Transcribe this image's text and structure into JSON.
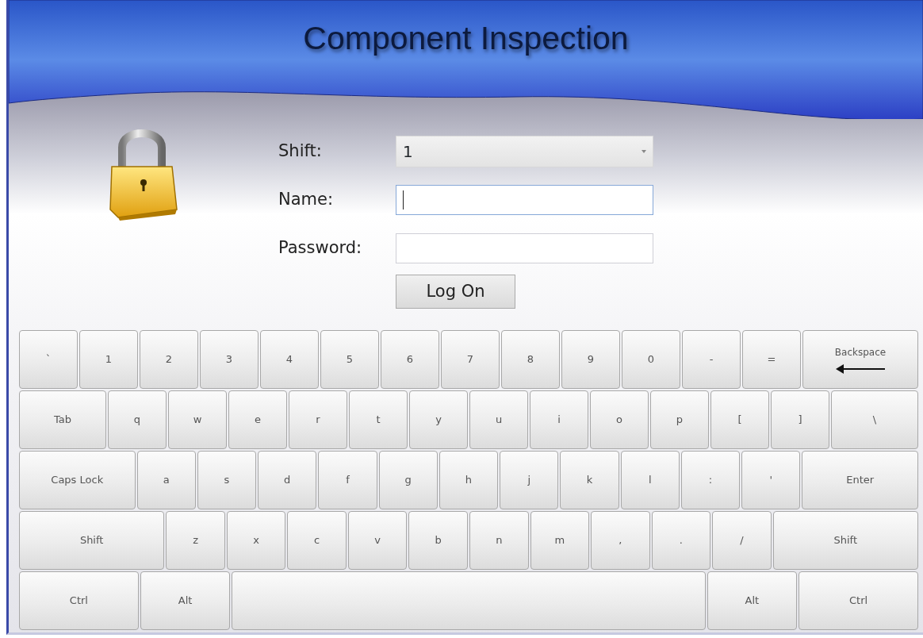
{
  "window": {
    "title": "Component Inspection"
  },
  "form": {
    "fields": [
      {
        "kind": "select",
        "label": "Shift:",
        "value": "1",
        "focused": false
      },
      {
        "kind": "text",
        "label": "Name:",
        "focused": true
      },
      {
        "kind": "password",
        "label": "Password:",
        "focused": false
      }
    ],
    "button": "Log On"
  },
  "keyboard": {
    "rows": [
      [
        {
          "kind": "char",
          "label": "`"
        },
        {
          "kind": "char",
          "label": "1"
        },
        {
          "kind": "char",
          "label": "2"
        },
        {
          "kind": "char",
          "label": "3"
        },
        {
          "kind": "char",
          "label": "4"
        },
        {
          "kind": "char",
          "label": "5"
        },
        {
          "kind": "char",
          "label": "6"
        },
        {
          "kind": "char",
          "label": "7"
        },
        {
          "kind": "char",
          "label": "8"
        },
        {
          "kind": "char",
          "label": "9"
        },
        {
          "kind": "char",
          "label": "0"
        },
        {
          "kind": "char",
          "label": "-"
        },
        {
          "kind": "char",
          "label": "="
        },
        {
          "kind": "backspace",
          "label": "Backspace"
        }
      ],
      [
        {
          "kind": "tab",
          "label": "Tab"
        },
        {
          "kind": "char",
          "label": "q"
        },
        {
          "kind": "char",
          "label": "w"
        },
        {
          "kind": "char",
          "label": "e"
        },
        {
          "kind": "char",
          "label": "r"
        },
        {
          "kind": "char",
          "label": "t"
        },
        {
          "kind": "char",
          "label": "y"
        },
        {
          "kind": "char",
          "label": "u"
        },
        {
          "kind": "char",
          "label": "i"
        },
        {
          "kind": "char",
          "label": "o"
        },
        {
          "kind": "char",
          "label": "p"
        },
        {
          "kind": "char",
          "label": "["
        },
        {
          "kind": "char",
          "label": "]"
        },
        {
          "kind": "tab",
          "label": "\\"
        }
      ],
      [
        {
          "kind": "caps",
          "label": "Caps Lock"
        },
        {
          "kind": "char",
          "label": "a"
        },
        {
          "kind": "char",
          "label": "s"
        },
        {
          "kind": "char",
          "label": "d"
        },
        {
          "kind": "char",
          "label": "f"
        },
        {
          "kind": "char",
          "label": "g"
        },
        {
          "kind": "char",
          "label": "h"
        },
        {
          "kind": "char",
          "label": "j"
        },
        {
          "kind": "char",
          "label": "k"
        },
        {
          "kind": "char",
          "label": "l"
        },
        {
          "kind": "char",
          "label": ":"
        },
        {
          "kind": "char",
          "label": "'"
        },
        {
          "kind": "caps",
          "label": "Enter"
        }
      ],
      [
        {
          "kind": "shift",
          "label": "Shift"
        },
        {
          "kind": "char",
          "label": "z"
        },
        {
          "kind": "char",
          "label": "x"
        },
        {
          "kind": "char",
          "label": "c"
        },
        {
          "kind": "char",
          "label": "v"
        },
        {
          "kind": "char",
          "label": "b"
        },
        {
          "kind": "char",
          "label": "n"
        },
        {
          "kind": "char",
          "label": "m"
        },
        {
          "kind": "char",
          "label": ","
        },
        {
          "kind": "char",
          "label": "."
        },
        {
          "kind": "char",
          "label": "/"
        },
        {
          "kind": "shift",
          "label": "Shift"
        }
      ],
      [
        {
          "kind": "ctrl",
          "label": "Ctrl"
        },
        {
          "kind": "alt",
          "label": "Alt"
        },
        {
          "kind": "space"
        },
        {
          "kind": "alt",
          "label": "Alt"
        },
        {
          "kind": "ctrl",
          "label": "Ctrl"
        }
      ]
    ]
  }
}
